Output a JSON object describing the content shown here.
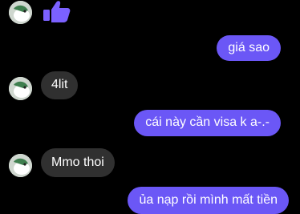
{
  "colors": {
    "background": "#000000",
    "incoming_bubble": "#303030",
    "outgoing_bubble": "#6b57f6",
    "like_icon": "#7b61ff"
  },
  "messages": [
    {
      "side": "incoming",
      "type": "like",
      "icon": "thumbs-up-icon"
    },
    {
      "side": "outgoing",
      "text": "giá sao"
    },
    {
      "side": "incoming",
      "text": "4lit"
    },
    {
      "side": "outgoing",
      "text": "cái này cần visa k a-.-"
    },
    {
      "side": "incoming",
      "text": "Mmo thoi"
    },
    {
      "side": "outgoing",
      "text": "ủa nạp rồi mình mất tiền"
    }
  ]
}
